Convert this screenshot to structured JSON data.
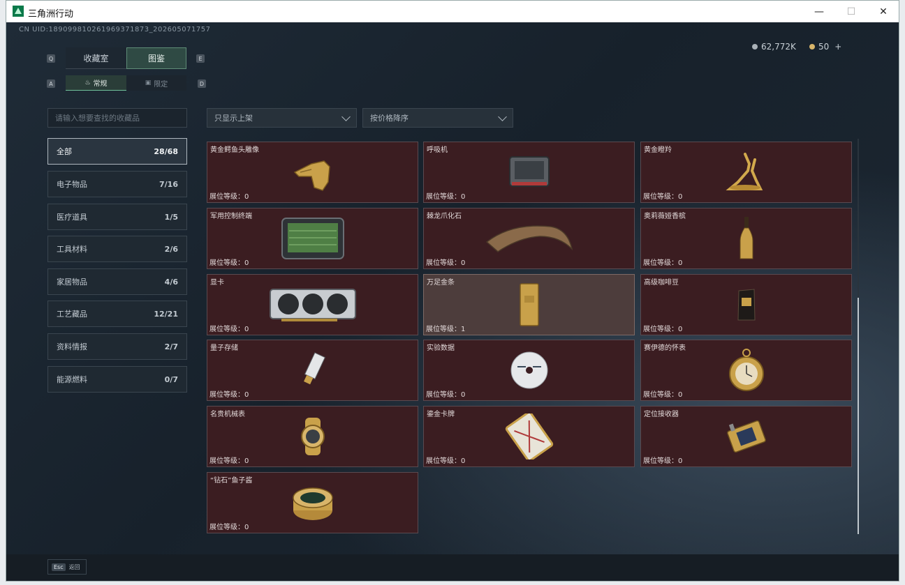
{
  "window": {
    "title": "三角洲行动",
    "controls": {
      "minimize": "—",
      "maximize": "☐",
      "close": "✕"
    }
  },
  "uid": "CN UID:189099810261969371873_202605071757",
  "currency": {
    "money": "62,772K",
    "coins": "50",
    "plus": "+"
  },
  "key_hints": {
    "q": "Q",
    "e": "E",
    "a": "A",
    "d": "D"
  },
  "tabs": {
    "collection_room": "收藏室",
    "catalog": "图鉴"
  },
  "subtabs": {
    "regular": "常规",
    "limited": "限定"
  },
  "search": {
    "placeholder": "请输入想要查找的收藏品",
    "value": ""
  },
  "filters": {
    "display": "只显示上架",
    "sort": "按价格降序"
  },
  "categories": [
    {
      "label": "全部",
      "count": "28/68",
      "active": true
    },
    {
      "label": "电子物品",
      "count": "7/16"
    },
    {
      "label": "医疗道具",
      "count": "1/5"
    },
    {
      "label": "工具材料",
      "count": "2/6"
    },
    {
      "label": "家居物品",
      "count": "4/6"
    },
    {
      "label": "工艺藏品",
      "count": "12/21"
    },
    {
      "label": "资料情报",
      "count": "2/7"
    },
    {
      "label": "能源燃料",
      "count": "0/7"
    }
  ],
  "level_label": "展位等级：",
  "items": [
    {
      "name": "黄金鳄鱼头雕像",
      "level": "0",
      "icon": "gold-crocodile-head-icon"
    },
    {
      "name": "呼吸机",
      "level": "0",
      "icon": "ventilator-icon"
    },
    {
      "name": "黄金瞪羚",
      "level": "0",
      "icon": "gold-gazelle-icon"
    },
    {
      "name": "军用控制终端",
      "level": "0",
      "icon": "control-terminal-icon"
    },
    {
      "name": "棘龙爪化石",
      "level": "0",
      "icon": "claw-fossil-icon"
    },
    {
      "name": "奥莉薇娅香槟",
      "level": "0",
      "icon": "champagne-icon"
    },
    {
      "name": "显卡",
      "level": "0",
      "icon": "graphics-card-icon"
    },
    {
      "name": "万足金条",
      "level": "1",
      "icon": "gold-bar-icon",
      "highlight": true
    },
    {
      "name": "高级咖啡豆",
      "level": "0",
      "icon": "coffee-bag-icon"
    },
    {
      "name": "量子存储",
      "level": "0",
      "icon": "usb-drive-icon"
    },
    {
      "name": "实验数据",
      "level": "0",
      "icon": "disc-icon"
    },
    {
      "name": "赛伊德的怀表",
      "level": "0",
      "icon": "pocket-watch-icon"
    },
    {
      "name": "名贵机械表",
      "level": "0",
      "icon": "wristwatch-icon"
    },
    {
      "name": "鎏金卡牌",
      "level": "0",
      "icon": "gilded-card-icon"
    },
    {
      "name": "定位接收器",
      "level": "0",
      "icon": "locator-receiver-icon"
    },
    {
      "name": "“钻石”鱼子酱",
      "level": "0",
      "icon": "caviar-tin-icon"
    }
  ],
  "bottom": {
    "esc_key": "Esc",
    "back": "返回"
  }
}
